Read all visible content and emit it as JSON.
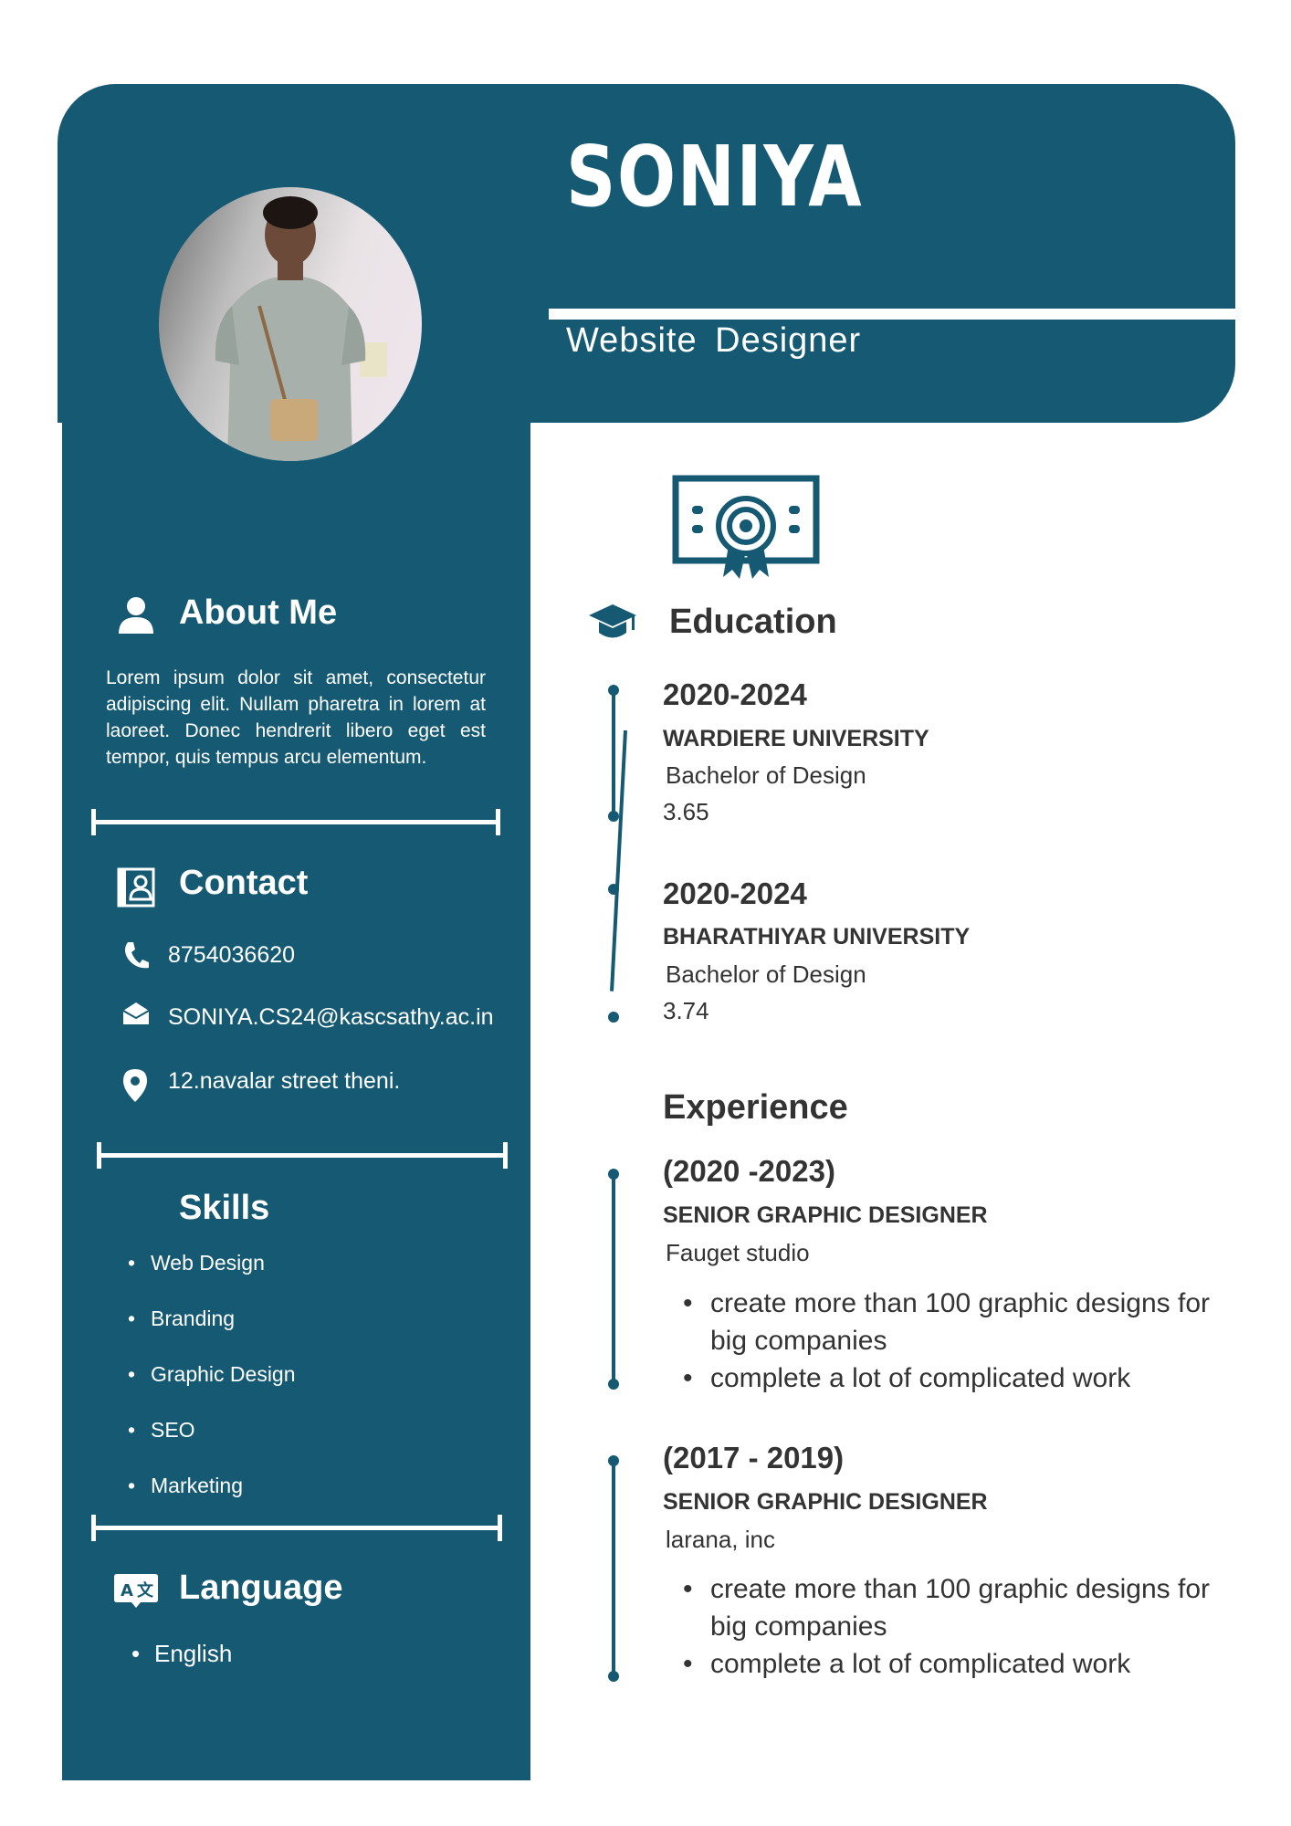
{
  "header": {
    "name": "SONIYA",
    "job_title": "Website  Designer"
  },
  "about": {
    "heading": "About Me",
    "text": "Lorem ipsum dolor sit amet, consectetur adipiscing elit. Nullam pharetra in lorem at laoreet. Donec hendrerit libero eget est tempor, quis tempus arcu elementum."
  },
  "contact": {
    "heading": "Contact",
    "phone": "8754036620",
    "email": "SONIYA.CS24@kascsathy.ac.in",
    "address": "12.navalar street theni."
  },
  "skills": {
    "heading": "Skills",
    "items": [
      "Web Design",
      "Branding",
      "Graphic Design",
      "SEO",
      "Marketing"
    ]
  },
  "language": {
    "heading": "Language",
    "items": [
      "English"
    ]
  },
  "education": {
    "heading": "Education",
    "entries": [
      {
        "years": "2020-2024",
        "school": "WARDIERE UNIVERSITY",
        "degree": "Bachelor of Design",
        "gpa": "3.65"
      },
      {
        "years": "2020-2024",
        "school": "BHARATHIYAR UNIVERSITY",
        "degree": "Bachelor of Design",
        "gpa": "3.74"
      }
    ]
  },
  "experience": {
    "heading": "Experience",
    "entries": [
      {
        "years": "(2020 -2023)",
        "role": "SENIOR GRAPHIC DESIGNER",
        "company": "Fauget studio",
        "bullets": [
          "create more than 100 graphic designs for big companies",
          "complete a lot of complicated work"
        ]
      },
      {
        "years": "(2017 - 2019)",
        "role": "SENIOR GRAPHIC DESIGNER",
        "company": "larana, inc",
        "bullets": [
          "create more than 100 graphic designs for big companies",
          "complete a lot of complicated work"
        ]
      }
    ]
  },
  "colors": {
    "accent": "#155a72",
    "text": "#333333",
    "background": "#ffffff"
  },
  "icons": [
    "user-icon",
    "contact-book-icon",
    "phone-icon",
    "mail-icon",
    "location-pin-icon",
    "translate-icon",
    "graduation-cap-icon",
    "certificate-icon"
  ]
}
